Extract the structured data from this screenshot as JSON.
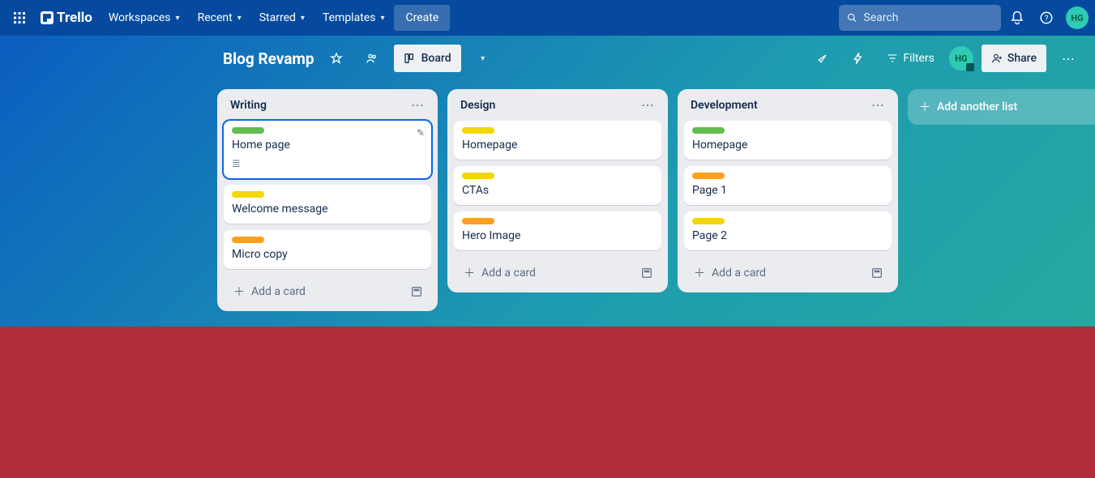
{
  "nav": {
    "logo": "Trello",
    "workspaces": "Workspaces",
    "recent": "Recent",
    "starred": "Starred",
    "templates": "Templates",
    "create": "Create",
    "search_placeholder": "Search",
    "avatar_initials": "HG"
  },
  "board_bar": {
    "title": "Blog Revamp",
    "view_label": "Board",
    "filters": "Filters",
    "share": "Share",
    "member_initials": "HG"
  },
  "lists": [
    {
      "title": "Writing",
      "cards": [
        {
          "label_color": "green",
          "title": "Home page",
          "selected": true,
          "has_description": true,
          "show_edit": true
        },
        {
          "label_color": "yellow",
          "title": "Welcome message"
        },
        {
          "label_color": "orange",
          "title": "Micro copy"
        }
      ]
    },
    {
      "title": "Design",
      "cards": [
        {
          "label_color": "yellow",
          "title": "Homepage"
        },
        {
          "label_color": "yellow",
          "title": "CTAs"
        },
        {
          "label_color": "orange",
          "title": "Hero Image"
        }
      ]
    },
    {
      "title": "Development",
      "cards": [
        {
          "label_color": "green",
          "title": "Homepage"
        },
        {
          "label_color": "orange",
          "title": "Page 1"
        },
        {
          "label_color": "yellow",
          "title": "Page 2"
        }
      ]
    }
  ],
  "add_card_label": "Add a card",
  "add_list_label": "Add another list"
}
